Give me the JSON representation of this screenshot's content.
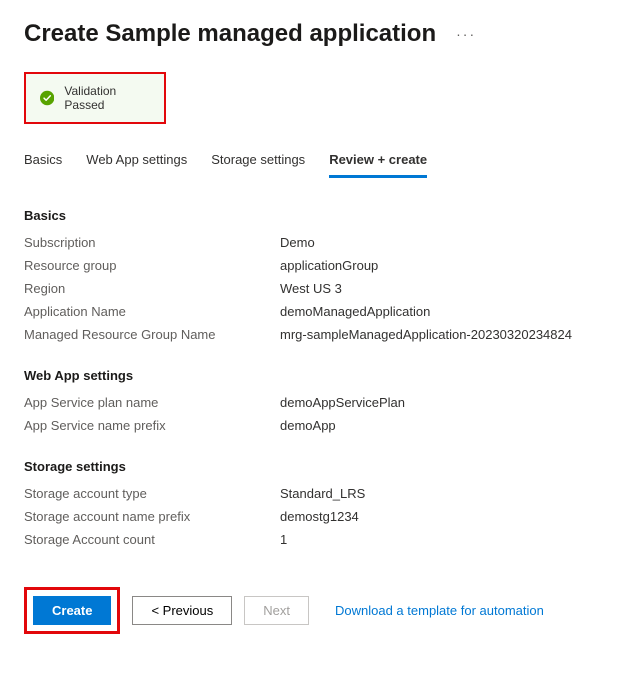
{
  "header": {
    "title": "Create Sample managed application"
  },
  "validation": {
    "message": "Validation Passed"
  },
  "tabs": [
    {
      "label": "Basics"
    },
    {
      "label": "Web App settings"
    },
    {
      "label": "Storage settings"
    },
    {
      "label": "Review + create"
    }
  ],
  "sections": {
    "basics": {
      "title": "Basics",
      "subscription_label": "Subscription",
      "subscription_value": "Demo",
      "resource_group_label": "Resource group",
      "resource_group_value": "applicationGroup",
      "region_label": "Region",
      "region_value": "West US 3",
      "app_name_label": "Application Name",
      "app_name_value": "demoManagedApplication",
      "mrg_label": "Managed Resource Group Name",
      "mrg_value": "mrg-sampleManagedApplication-20230320234824"
    },
    "webapp": {
      "title": "Web App settings",
      "plan_label": "App Service plan name",
      "plan_value": "demoAppServicePlan",
      "prefix_label": "App Service name prefix",
      "prefix_value": "demoApp"
    },
    "storage": {
      "title": "Storage settings",
      "type_label": "Storage account type",
      "type_value": "Standard_LRS",
      "prefix_label": "Storage account name prefix",
      "prefix_value": "demostg1234",
      "count_label": "Storage Account count",
      "count_value": "1"
    }
  },
  "footer": {
    "create": "Create",
    "previous": "< Previous",
    "next": "Next",
    "download": "Download a template for automation"
  }
}
